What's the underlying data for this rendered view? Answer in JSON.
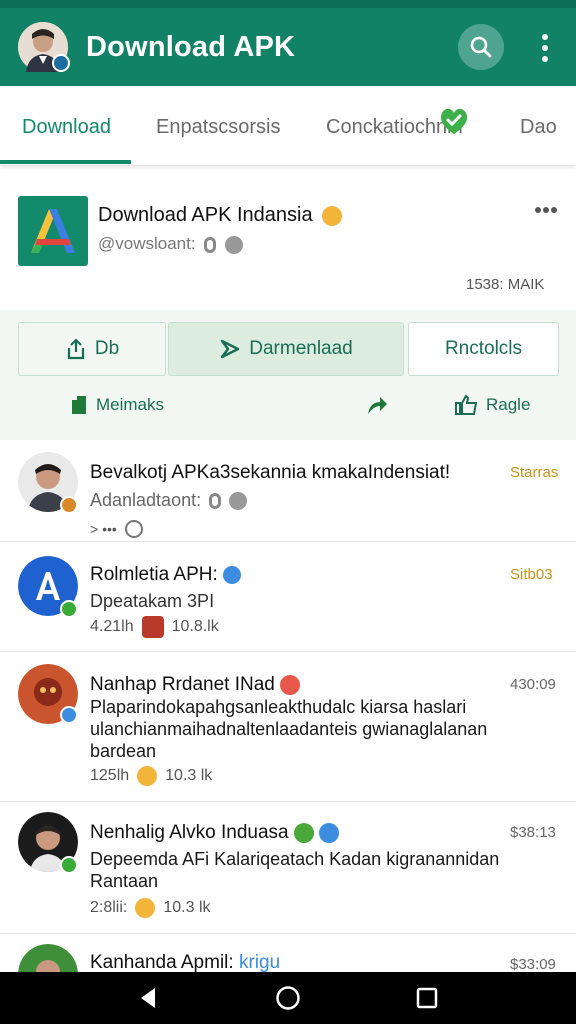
{
  "appbar": {
    "title": "Download APK"
  },
  "tabs": [
    {
      "label": "Download"
    },
    {
      "label": "Enpatscsorsis"
    },
    {
      "label": "Conckatiochnin"
    },
    {
      "label": "Dao"
    }
  ],
  "card": {
    "title": "Download APK Indansia",
    "handle": "@vowsloant:",
    "count": "1538: MAIK"
  },
  "actions": {
    "primary": [
      {
        "label": "Db"
      },
      {
        "label": "Darmenlaad"
      },
      {
        "label": "Rnctolcls"
      }
    ],
    "secondary": [
      {
        "label": "Meimaks"
      },
      {
        "label": ""
      },
      {
        "label": "Ragle"
      }
    ]
  },
  "feed": [
    {
      "name": "Bevalkotj APKa3sekannia kmakaIndensiat!",
      "time": "Starras",
      "text": "Adanladtaont:",
      "meta": "> •••"
    },
    {
      "name": "Rolmletia APH:",
      "time": "Sitb03",
      "text": "Dpeatakam 3PI",
      "likes": "4.21lh",
      "views": "10.8.lk"
    },
    {
      "name": "Nanhap Rrdanet INad",
      "time": "430:09",
      "text": "Plaparindokapahgsanleakthudalc kiarsa haslari ulanchianmaihadnaltenlaadanteis gwianaglalanan bardean",
      "likes": "125lh",
      "views": "10.3 lk"
    },
    {
      "name": "Nenhalig Alvko Induasa",
      "time": "$38:13",
      "text": "Depeemda AFi Kalariqeatach Kadan kigranannidan Rantaan",
      "likes": "2:8lii:",
      "views": "10.3 lk"
    },
    {
      "name": "Kanhanda Apmil:",
      "name_suffix": "krigu",
      "time": "$33:09"
    }
  ],
  "colors": {
    "primary": "#118266",
    "accent_text": "#1a6d55",
    "time_gold": "#c99518"
  }
}
